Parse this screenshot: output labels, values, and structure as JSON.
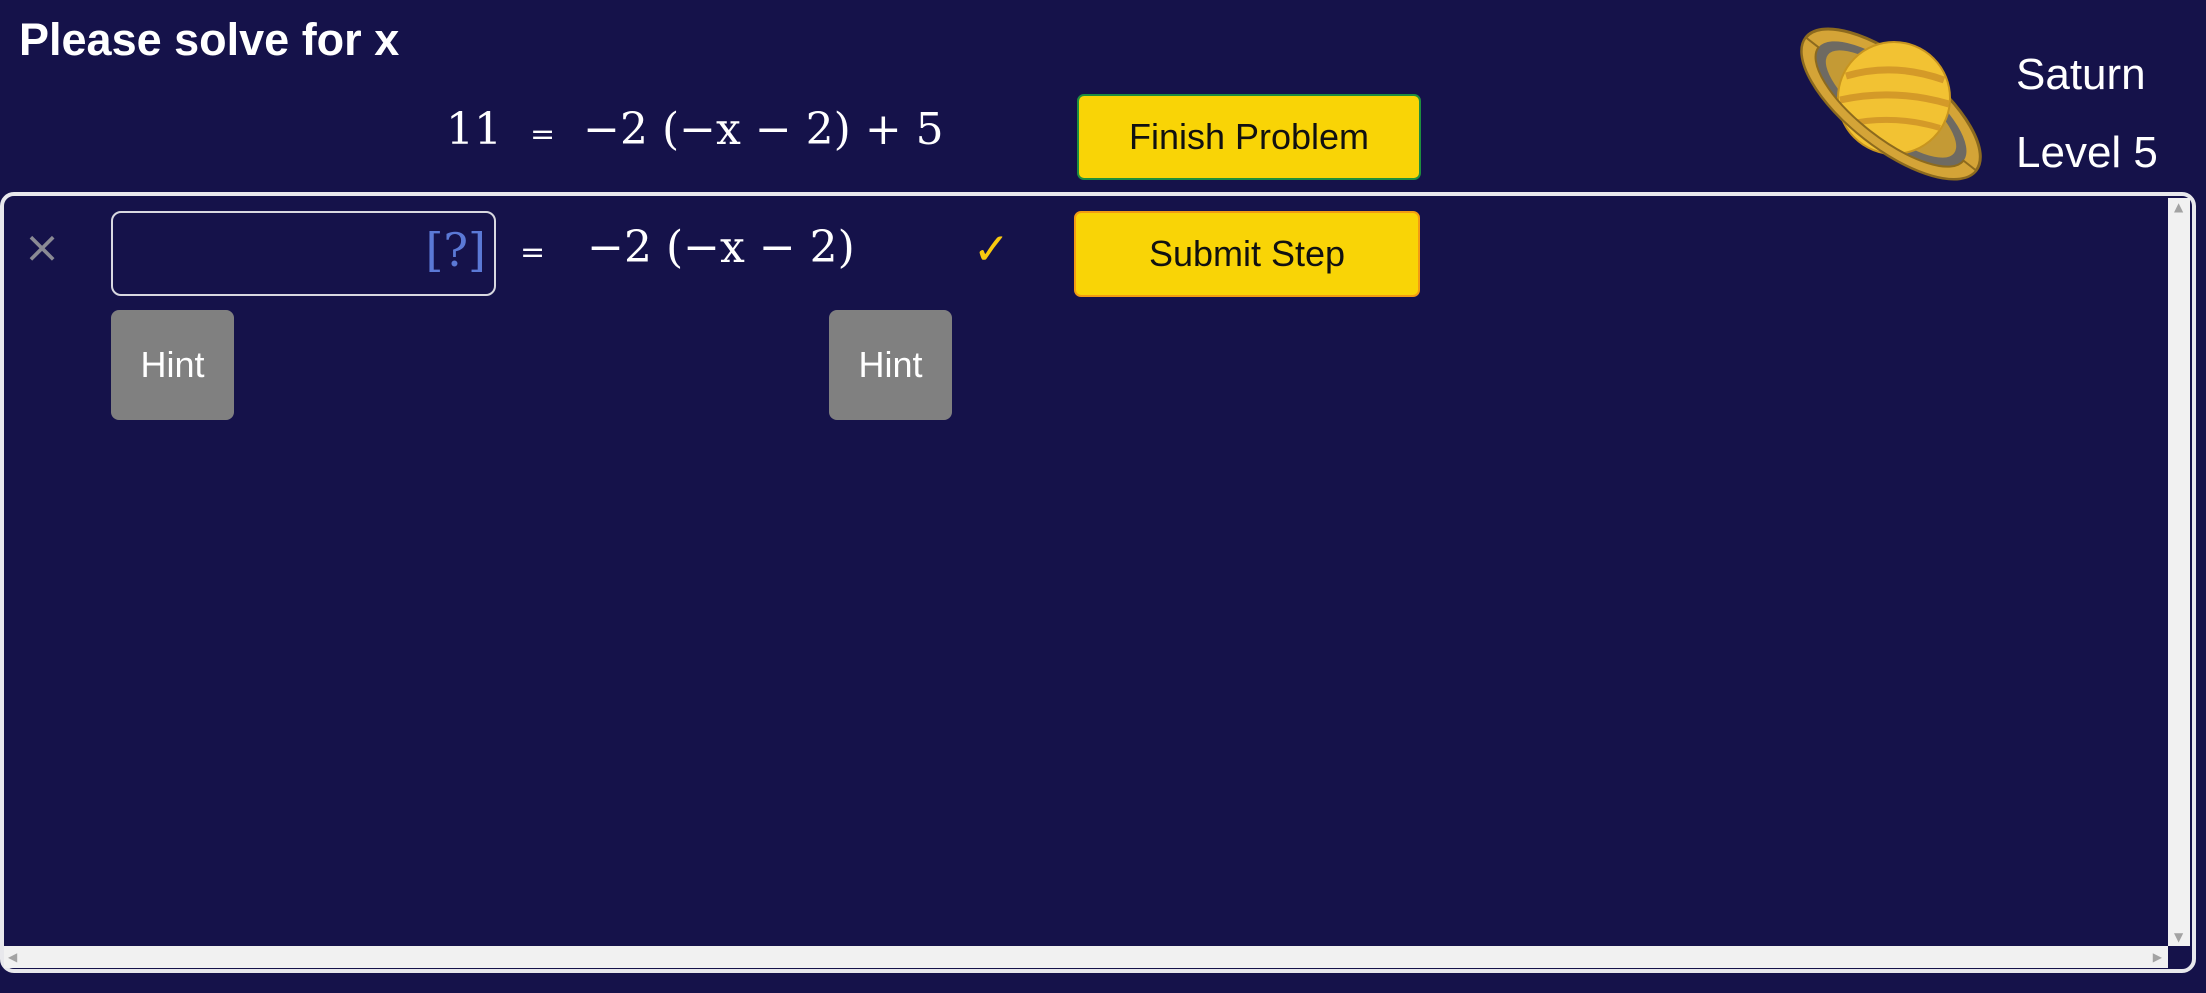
{
  "header": {
    "title": "Please solve for x"
  },
  "problem": {
    "lhs": "11",
    "equals": "=",
    "rhs": "−2 (−x − 2) + 5"
  },
  "buttons": {
    "finish_label": "Finish Problem",
    "submit_label": "Submit Step",
    "hint_label": "Hint"
  },
  "level_info": {
    "planet": "Saturn",
    "level": "Level 5"
  },
  "step": {
    "input_value": "",
    "input_placeholder": "[?]",
    "equals": "=",
    "rhs": "−2 (−x − 2)",
    "close_glyph": "×",
    "check_glyph": "✓"
  },
  "colors": {
    "background": "#15124a",
    "button_yellow": "#f9d406",
    "hint_gray": "#808080",
    "check_color": "#f9c90f",
    "placeholder_blue": "#5b79d6"
  },
  "icons": {
    "planet": "saturn-icon",
    "close": "close-icon",
    "check": "checkmark-icon"
  }
}
